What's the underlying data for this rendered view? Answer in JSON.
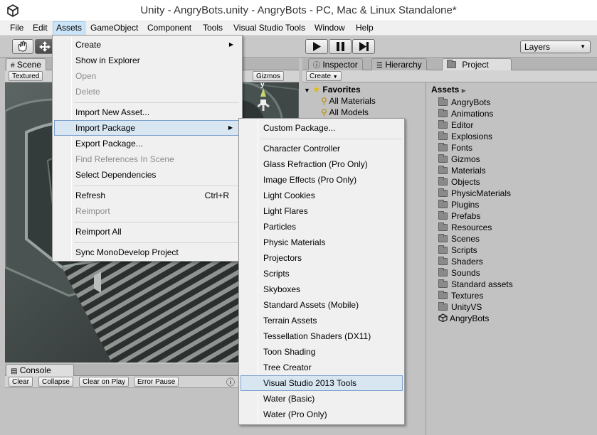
{
  "window": {
    "title": "Unity - AngryBots.unity - AngryBots - PC, Mac & Linux Standalone*"
  },
  "menubar": {
    "items": [
      "File",
      "Edit",
      "Assets",
      "GameObject",
      "Component",
      "Tools",
      "Visual Studio Tools",
      "Window",
      "Help"
    ]
  },
  "toolbar": {
    "layers_label": "Layers"
  },
  "scene": {
    "tab": "Scene",
    "shading": "Textured",
    "gizmos": "Gizmos",
    "axis": "y"
  },
  "tabs": {
    "inspector": "Inspector",
    "hierarchy": "Hierarchy",
    "project": "Project"
  },
  "project": {
    "create_label": "Create",
    "favorites_label": "Favorites",
    "favorites": [
      "All Materials",
      "All Models"
    ],
    "assets_label": "Assets",
    "folders": [
      "AngryBots",
      "Animations",
      "Editor",
      "Explosions",
      "Fonts",
      "Gizmos",
      "Materials",
      "Objects",
      "PhysicMaterials",
      "Plugins",
      "Prefabs",
      "Resources",
      "Scenes",
      "Scripts",
      "Shaders",
      "Sounds",
      "Standard assets",
      "Textures",
      "UnityVS"
    ],
    "scene_file": "AngryBots"
  },
  "console": {
    "tab": "Console",
    "buttons": [
      "Clear",
      "Collapse",
      "Clear on Play",
      "Error Pause"
    ]
  },
  "assets_menu": {
    "items": [
      {
        "label": "Create",
        "submenu": true
      },
      {
        "label": "Show in Explorer"
      },
      {
        "label": "Open",
        "disabled": true
      },
      {
        "label": "Delete",
        "disabled": true
      },
      {
        "label": "Import New Asset..."
      },
      {
        "label": "Import Package",
        "submenu": true,
        "highlighted": true
      },
      {
        "label": "Export Package..."
      },
      {
        "label": "Find References In Scene",
        "disabled": true
      },
      {
        "label": "Select Dependencies"
      },
      {
        "label": "Refresh",
        "shortcut": "Ctrl+R"
      },
      {
        "label": "Reimport",
        "disabled": true
      },
      {
        "label": "Reimport All"
      },
      {
        "label": "Sync MonoDevelop Project"
      }
    ]
  },
  "import_package_menu": {
    "items": [
      "Custom Package...",
      "Character Controller",
      "Glass Refraction (Pro Only)",
      "Image Effects (Pro Only)",
      "Light Cookies",
      "Light Flares",
      "Particles",
      "Physic Materials",
      "Projectors",
      "Scripts",
      "Skyboxes",
      "Standard Assets (Mobile)",
      "Terrain Assets",
      "Tessellation Shaders (DX11)",
      "Toon Shading",
      "Tree Creator",
      "Visual Studio 2013 Tools",
      "Water (Basic)",
      "Water (Pro Only)"
    ],
    "highlighted_index": 16
  },
  "colors": {
    "highlight": "#d8e6f2",
    "highlight_border": "#7da2ce",
    "menu_bg": "#f0f0f0",
    "panel_bg": "#c2c2c2"
  }
}
